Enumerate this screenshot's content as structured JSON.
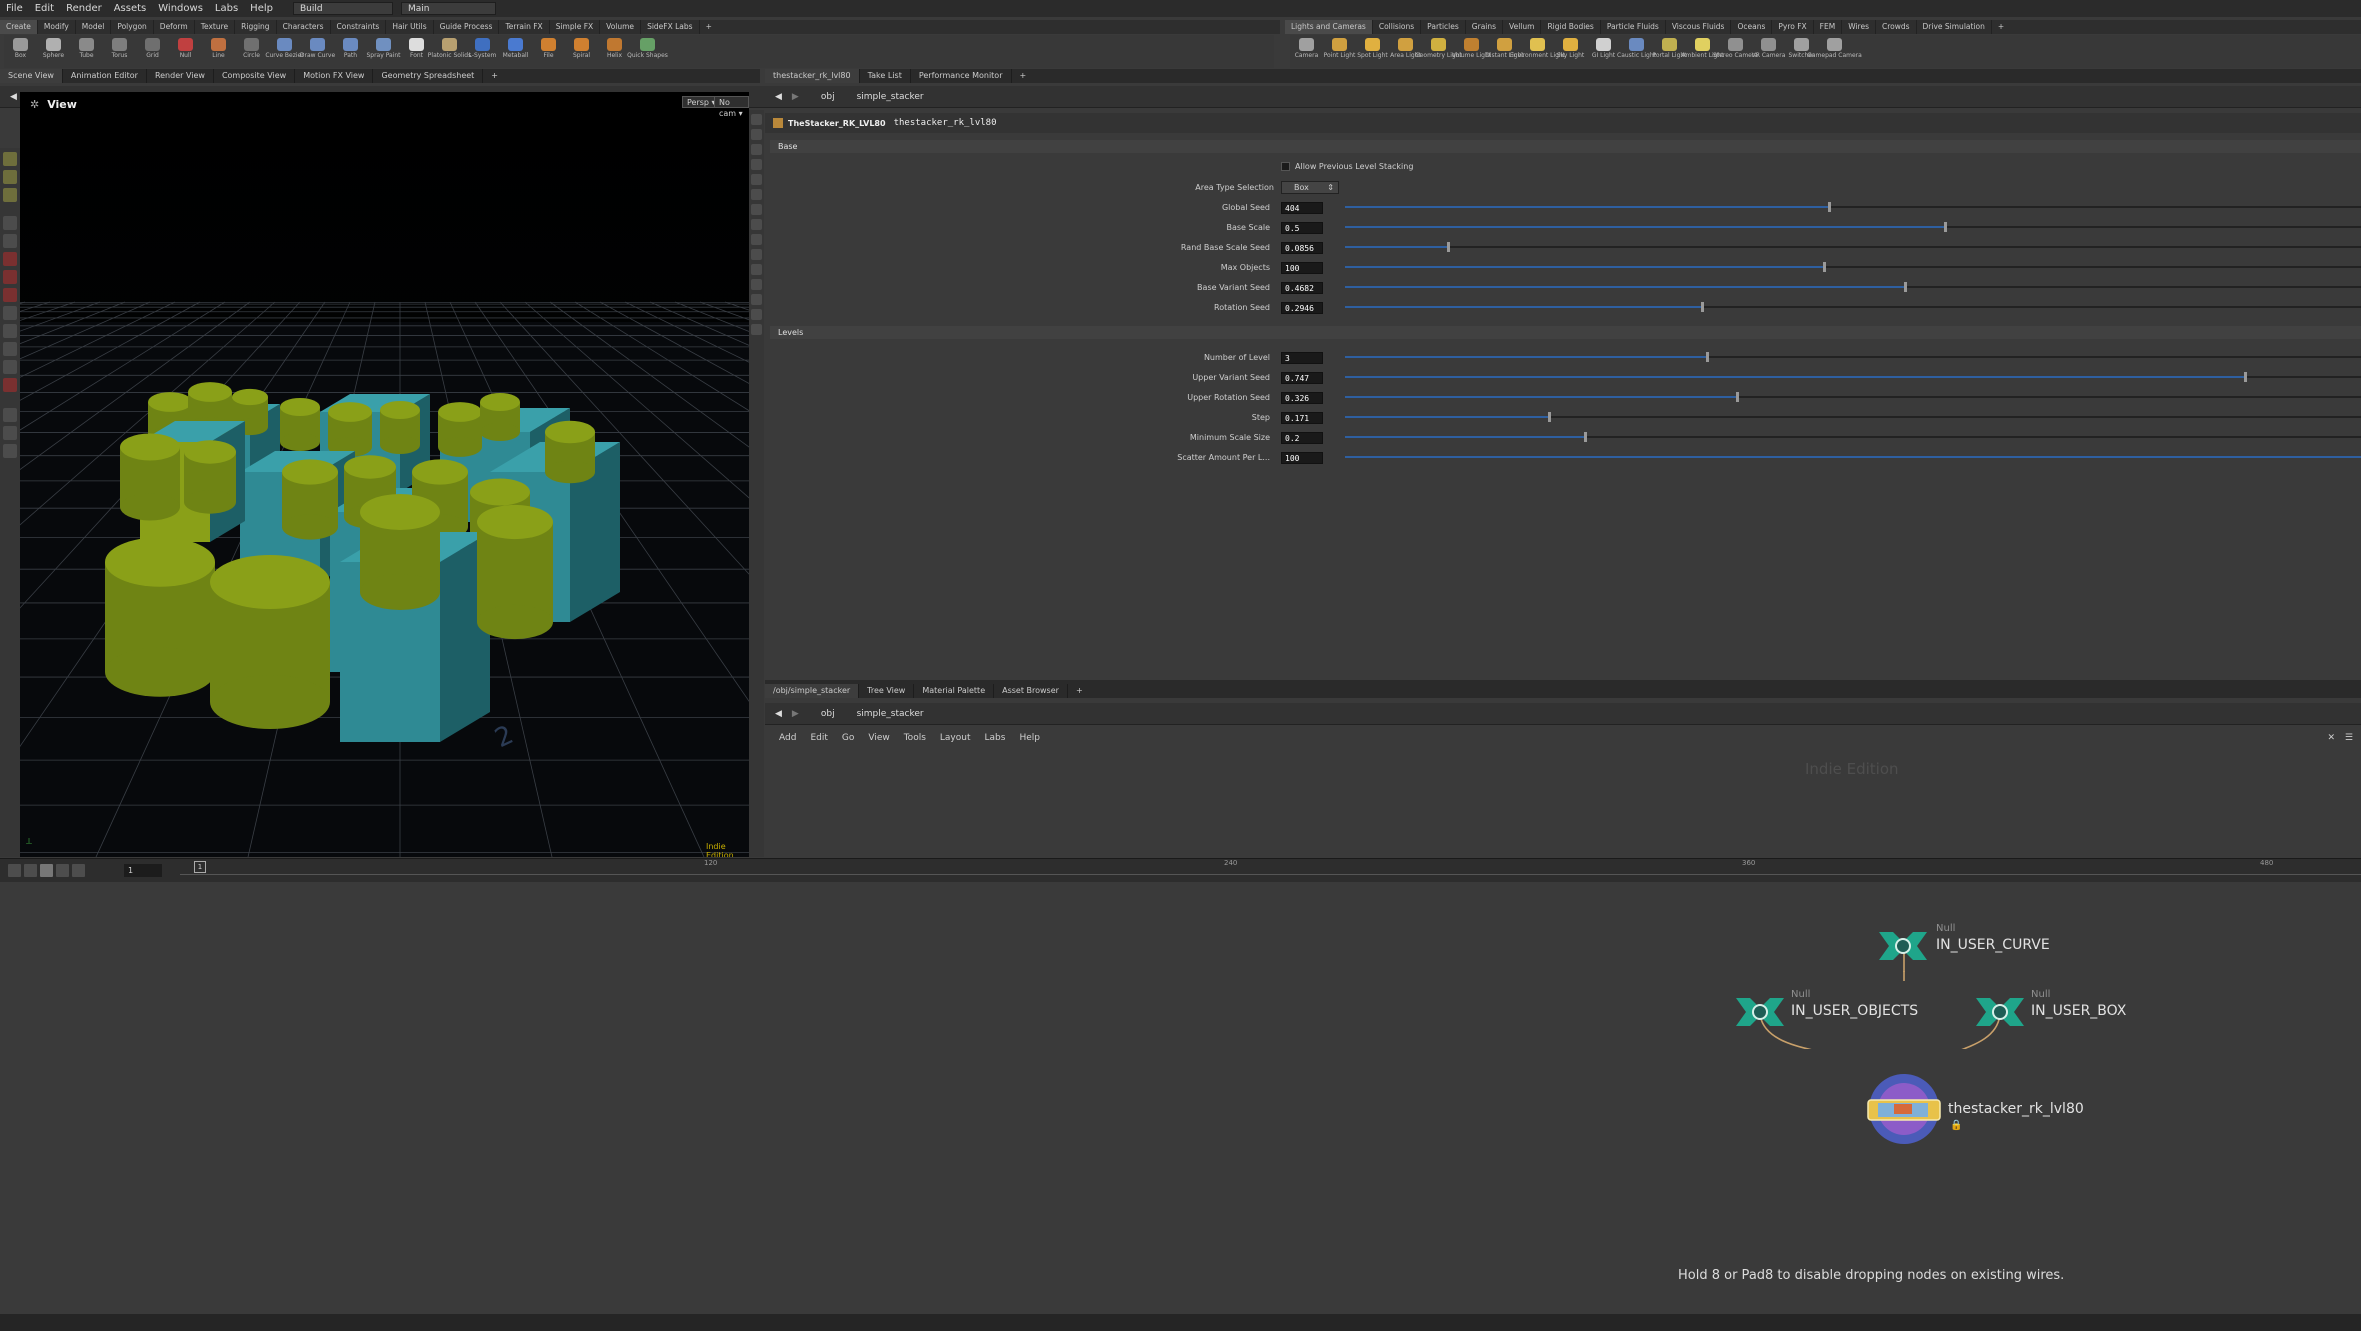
{
  "menubar": {
    "items": [
      "File",
      "Edit",
      "Render",
      "Assets",
      "Windows",
      "Labs",
      "Help"
    ],
    "desktop_dropdown": "Build",
    "context_dropdown": "Main"
  },
  "shelf_left": {
    "tabs": [
      "Create",
      "Modify",
      "Model",
      "Polygon",
      "Deform",
      "Texture",
      "Rigging",
      "Characters",
      "Constraints",
      "Hair Utils",
      "Guide Process",
      "Terrain FX",
      "Simple FX",
      "Volume",
      "SideFX Labs"
    ],
    "tools": [
      "Box",
      "Sphere",
      "Tube",
      "Torus",
      "Grid",
      "Null",
      "Line",
      "Circle",
      "Curve Bezier",
      "Draw Curve",
      "Path",
      "Spray Paint",
      "Font",
      "Platonic Solids",
      "L-System",
      "Metaball",
      "File",
      "Spiral",
      "Helix",
      "Quick Shapes"
    ]
  },
  "shelf_right": {
    "tabs": [
      "Lights and Cameras",
      "Collisions",
      "Particles",
      "Grains",
      "Vellum",
      "Rigid Bodies",
      "Particle Fluids",
      "Viscous Fluids",
      "Oceans",
      "Pyro FX",
      "FEM",
      "Wires",
      "Crowds",
      "Drive Simulation"
    ],
    "tools": [
      "Camera",
      "Point Light",
      "Spot Light",
      "Area Light",
      "Geometry Light",
      "Volume Light",
      "Distant Light",
      "Environment Light",
      "Sky Light",
      "GI Light",
      "Caustic Light",
      "Portal Light",
      "Ambient Light",
      "Stereo Camera",
      "VR Camera",
      "Switcher",
      "Gamepad Camera"
    ]
  },
  "left_pane": {
    "tabs": [
      "Scene View",
      "Animation Editor",
      "Render View",
      "Composite View",
      "Motion FX View",
      "Geometry Spreadsheet"
    ],
    "path": [
      "obj",
      "simple_stacker"
    ],
    "view_label": "View",
    "persp_btn": "Persp",
    "cam_btn": "No cam",
    "watermark": "Indie Edition",
    "grid_number": "2"
  },
  "params_pane": {
    "tabs": [
      "thestacker_rk_lvl80",
      "Take List",
      "Performance Monitor"
    ],
    "path": [
      "obj",
      "simple_stacker"
    ],
    "node_type": "TheStacker_RK_LVL80",
    "node_name": "thestacker_rk_lvl80",
    "base_section": "Base",
    "allow_label": "Allow Previous Level Stacking",
    "area_type_label": "Area Type Selection",
    "area_type_value": "Box",
    "base_params": [
      {
        "label": "Global Seed",
        "value": "404",
        "frac": 0.475
      },
      {
        "label": "Base Scale",
        "value": "0.5",
        "frac": 0.59
      },
      {
        "label": "Rand Base Scale Seed",
        "value": "0.0856",
        "frac": 0.1
      },
      {
        "label": "Max Objects",
        "value": "100",
        "frac": 0.47
      },
      {
        "label": "Base Variant Seed",
        "value": "0.4682",
        "frac": 0.55
      },
      {
        "label": "Rotation Seed",
        "value": "0.2946",
        "frac": 0.35
      }
    ],
    "levels_section": "Levels",
    "level_params": [
      {
        "label": "Number of Level",
        "value": "3",
        "frac": 0.355
      },
      {
        "label": "Upper Variant Seed",
        "value": "0.747",
        "frac": 0.885
      },
      {
        "label": "Upper Rotation Seed",
        "value": "0.326",
        "frac": 0.385
      },
      {
        "label": "Step",
        "value": "0.171",
        "frac": 0.2
      },
      {
        "label": "Minimum Scale Size",
        "value": "0.2",
        "frac": 0.235
      },
      {
        "label": "Scatter Amount Per L...",
        "value": "100",
        "frac": 1.0
      }
    ]
  },
  "network_pane": {
    "tabs": [
      "/obj/simple_stacker",
      "Tree View",
      "Material Palette",
      "Asset Browser"
    ],
    "path": [
      "obj",
      "simple_stacker"
    ],
    "menu": [
      "Add",
      "Edit",
      "Go",
      "View",
      "Tools",
      "Layout",
      "Labs",
      "Help"
    ],
    "watermark": "Indie Edition",
    "hint": "Hold 8 or Pad8 to disable dropping nodes on existing wires.",
    "nodes": [
      {
        "type": "Null",
        "name": "IN_USER_CURVE"
      },
      {
        "type": "Null",
        "name": "IN_USER_OBJECTS"
      },
      {
        "type": "Null",
        "name": "IN_USER_BOX"
      },
      {
        "type": "",
        "name": "thestacker_rk_lvl80"
      }
    ]
  },
  "timeline": {
    "frame": "1",
    "marker": "1",
    "ticks": [
      "120",
      "240",
      "360",
      "480"
    ]
  },
  "colors": {
    "green_block": "#8aa018",
    "teal_block": "#2f8a94",
    "node_teal": "#1fa58a",
    "slider_fill": "#2e5fa0"
  }
}
